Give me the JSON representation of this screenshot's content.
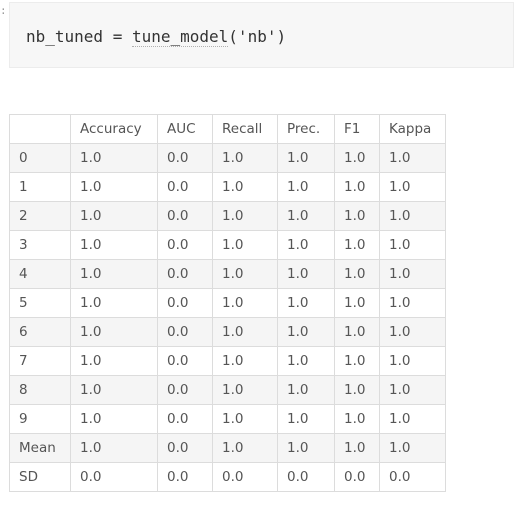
{
  "code": {
    "var_part": "nb_tuned = ",
    "fn_part": "tune_model",
    "args_part": "('nb')"
  },
  "table": {
    "columns": [
      "",
      "Accuracy",
      "AUC",
      "Recall",
      "Prec.",
      "F1",
      "Kappa"
    ],
    "rows": [
      [
        "0",
        "1.0",
        "0.0",
        "1.0",
        "1.0",
        "1.0",
        "1.0"
      ],
      [
        "1",
        "1.0",
        "0.0",
        "1.0",
        "1.0",
        "1.0",
        "1.0"
      ],
      [
        "2",
        "1.0",
        "0.0",
        "1.0",
        "1.0",
        "1.0",
        "1.0"
      ],
      [
        "3",
        "1.0",
        "0.0",
        "1.0",
        "1.0",
        "1.0",
        "1.0"
      ],
      [
        "4",
        "1.0",
        "0.0",
        "1.0",
        "1.0",
        "1.0",
        "1.0"
      ],
      [
        "5",
        "1.0",
        "0.0",
        "1.0",
        "1.0",
        "1.0",
        "1.0"
      ],
      [
        "6",
        "1.0",
        "0.0",
        "1.0",
        "1.0",
        "1.0",
        "1.0"
      ],
      [
        "7",
        "1.0",
        "0.0",
        "1.0",
        "1.0",
        "1.0",
        "1.0"
      ],
      [
        "8",
        "1.0",
        "0.0",
        "1.0",
        "1.0",
        "1.0",
        "1.0"
      ],
      [
        "9",
        "1.0",
        "0.0",
        "1.0",
        "1.0",
        "1.0",
        "1.0"
      ],
      [
        "Mean",
        "1.0",
        "0.0",
        "1.0",
        "1.0",
        "1.0",
        "1.0"
      ],
      [
        "SD",
        "0.0",
        "0.0",
        "0.0",
        "0.0",
        "0.0",
        "0.0"
      ]
    ]
  }
}
